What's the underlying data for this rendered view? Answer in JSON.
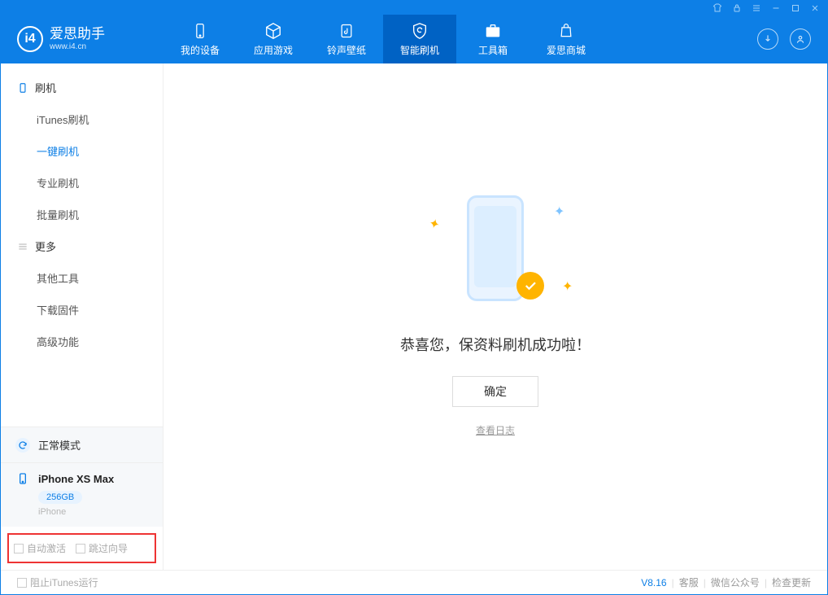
{
  "logo": {
    "cn": "爱思助手",
    "en": "www.i4.cn"
  },
  "nav": {
    "device": "我的设备",
    "apps": "应用游戏",
    "ringtone": "铃声壁纸",
    "flash": "智能刷机",
    "toolbox": "工具箱",
    "store": "爱思商城"
  },
  "sidebar": {
    "group_flash": "刷机",
    "items_flash": [
      "iTunes刷机",
      "一键刷机",
      "专业刷机",
      "批量刷机"
    ],
    "group_more": "更多",
    "items_more": [
      "其他工具",
      "下载固件",
      "高级功能"
    ]
  },
  "mode": {
    "label": "正常模式"
  },
  "device": {
    "name": "iPhone XS Max",
    "capacity": "256GB",
    "type": "iPhone"
  },
  "checks": {
    "auto_activate": "自动激活",
    "skip_guide": "跳过向导"
  },
  "success": {
    "title": "恭喜您，保资料刷机成功啦！",
    "ok": "确定",
    "log": "查看日志"
  },
  "footer": {
    "block_itunes": "阻止iTunes运行",
    "version": "V8.16",
    "service": "客服",
    "wechat": "微信公众号",
    "update": "检查更新"
  }
}
